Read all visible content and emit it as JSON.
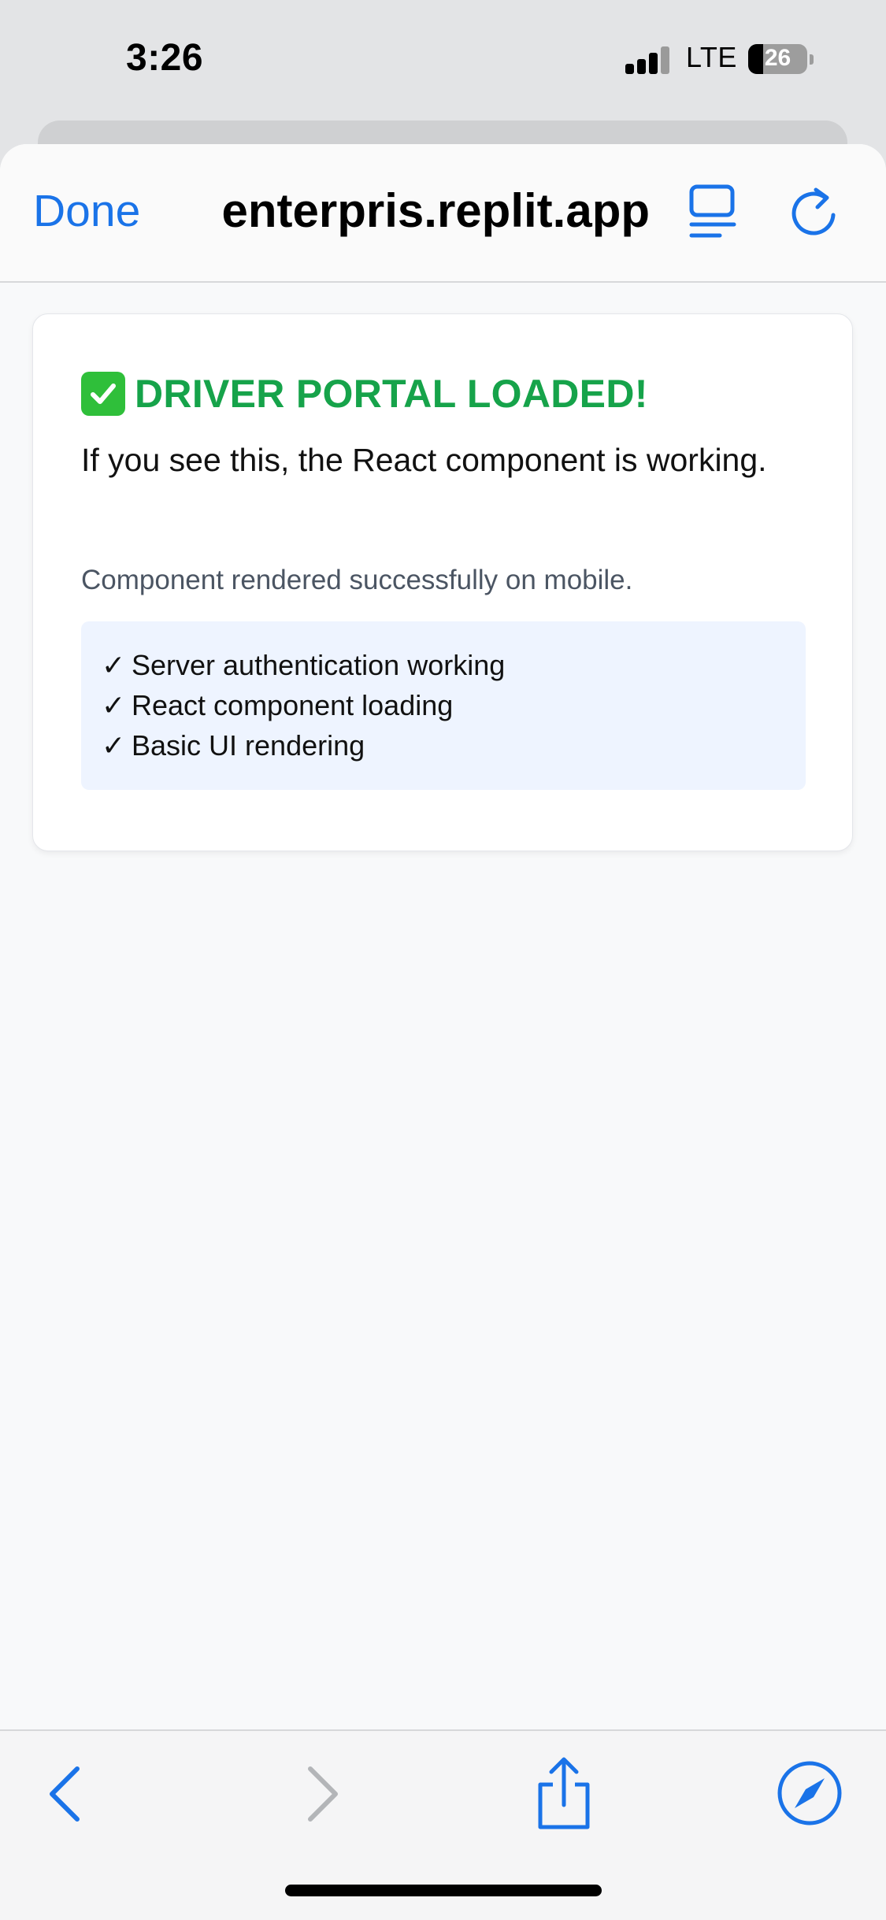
{
  "status_bar": {
    "time": "3:26",
    "network": "LTE",
    "battery_level": "26",
    "icons": [
      "signal-icon",
      "battery-icon"
    ]
  },
  "browser": {
    "done_label": "Done",
    "url": "enterpris.replit.app",
    "accent_color": "#1a73e8",
    "icons": [
      "reader-mode-icon",
      "reload-icon"
    ]
  },
  "card": {
    "title": "DRIVER PORTAL LOADED!",
    "title_color": "#16a34a",
    "title_icon": "check-mark-button-icon",
    "body": "If you see this, the React component is working.",
    "subtitle": "Component rendered successfully on mobile.",
    "checklist": [
      {
        "mark": "✓",
        "text": "Server authentication working"
      },
      {
        "mark": "✓",
        "text": "React component loading"
      },
      {
        "mark": "✓",
        "text": "Basic UI rendering"
      }
    ]
  },
  "toolbar": {
    "icons": [
      "back-chevron-icon",
      "forward-chevron-icon",
      "share-icon",
      "compass-icon"
    ],
    "forward_enabled": false
  }
}
